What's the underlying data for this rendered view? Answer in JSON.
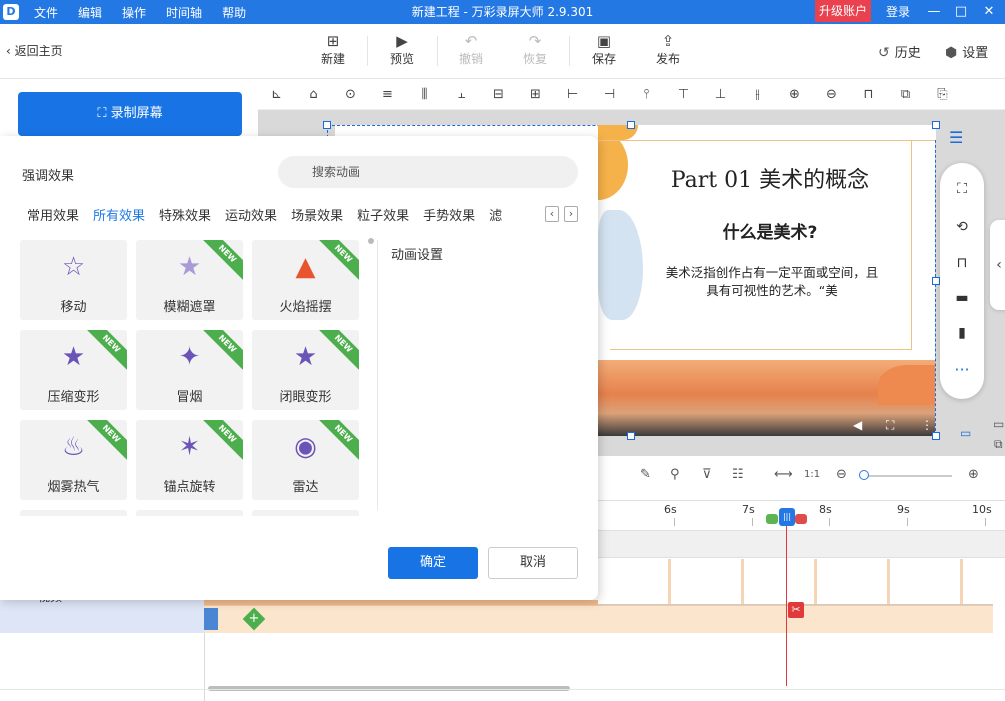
{
  "titlebar": {
    "logo": "D",
    "title": "新建工程 - 万彩录屏大师 2.9.301",
    "menu": [
      "文件",
      "编辑",
      "操作",
      "时间轴",
      "帮助"
    ],
    "upgrade": "升级账户",
    "login": "登录",
    "minimize": "—",
    "restore": "□",
    "close": "✕"
  },
  "toolbar": {
    "back": "返回主页",
    "new": "新建",
    "preview": "预览",
    "undo": "撤销",
    "redo": "恢复",
    "save": "保存",
    "publish": "发布",
    "history": "历史",
    "settings": "设置"
  },
  "left": {
    "record": "录制屏幕"
  },
  "slide": {
    "title": "Part 01 美术的概念",
    "subtitle": "什么是美术?",
    "body": "美术泛指创作占有一定平面或空间，且具有可视性的艺术。“美"
  },
  "dialog": {
    "title": "强调效果",
    "search_placeholder": "搜索动画",
    "categories": [
      "常用效果",
      "所有效果",
      "特殊效果",
      "运动效果",
      "场景效果",
      "粒子效果",
      "手势效果",
      "滤"
    ],
    "active_category": "所有效果",
    "cards": [
      {
        "label": "移动",
        "icon": "path-stars-icon",
        "new": false
      },
      {
        "label": "模糊遮罩",
        "icon": "blur-star-icon",
        "new": true
      },
      {
        "label": "火焰摇摆",
        "icon": "flame-icon",
        "new": true
      },
      {
        "label": "压缩变形",
        "icon": "compress-star-icon",
        "new": true
      },
      {
        "label": "冒烟",
        "icon": "smoke-icon",
        "new": true
      },
      {
        "label": "闭眼变形",
        "icon": "blink-star-icon",
        "new": true
      },
      {
        "label": "烟雾热气",
        "icon": "steam-icon",
        "new": true
      },
      {
        "label": "锚点旋转",
        "icon": "anchor-rotate-icon",
        "new": true
      },
      {
        "label": "雷达",
        "icon": "radar-icon",
        "new": true
      }
    ],
    "new_badge": "NEW",
    "settings_label": "动画设置",
    "ok": "确定",
    "cancel": "取消"
  },
  "timeline": {
    "ruler": [
      "6s",
      "7s",
      "8s",
      "9s",
      "10s"
    ],
    "track_label": "视频"
  },
  "colors": {
    "accent": "#1874e5",
    "titlebar": "#2478e4",
    "upgrade": "#e9424e",
    "new_badge": "#4cae4c",
    "playhead": "#e03a3a"
  }
}
